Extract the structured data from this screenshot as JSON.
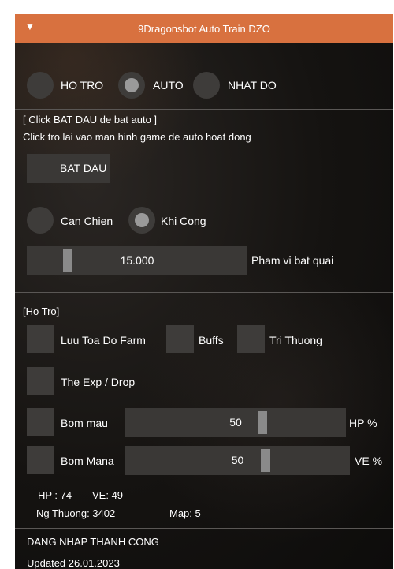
{
  "window": {
    "title": "9Dragonsbot Auto Train DZO",
    "accent": "#d8713f"
  },
  "modes": {
    "items": [
      {
        "label": "HO TRO",
        "selected": false
      },
      {
        "label": "AUTO",
        "selected": true
      },
      {
        "label": "NHAT DO",
        "selected": false
      }
    ]
  },
  "info": {
    "line1": "[ Click BAT DAU de bat auto ]",
    "line2": "Click tro lai vao man hinh game de auto hoat dong"
  },
  "start_button": "BAT DAU",
  "attack": {
    "items": [
      {
        "label": "Can Chien",
        "selected": false
      },
      {
        "label": "Khi Cong",
        "selected": true
      }
    ]
  },
  "range": {
    "value": "15.000",
    "label": "Pham vi bat quai",
    "fraction": 0.15
  },
  "support": {
    "header": "[Ho Tro]",
    "options": [
      {
        "label": "Luu Toa Do Farm",
        "checked": false
      },
      {
        "label": "Buffs",
        "checked": false
      },
      {
        "label": "Tri Thuong",
        "checked": false
      },
      {
        "label": "The Exp / Drop",
        "checked": false
      }
    ],
    "hp_potion": {
      "label": "Bom mau",
      "value": "50",
      "unit": "HP %",
      "fraction": 0.5
    },
    "mana_potion": {
      "label": "Bom Mana",
      "value": "50",
      "unit": "VE %",
      "fraction": 0.5
    }
  },
  "stats": {
    "hp": "HP : 74",
    "ve": "VE: 49",
    "ng_thuong": "Ng Thuong: 3402",
    "map": "Map: 5"
  },
  "status": {
    "message": "DANG NHAP THANH CONG",
    "updated": "Updated 26.01.2023"
  }
}
